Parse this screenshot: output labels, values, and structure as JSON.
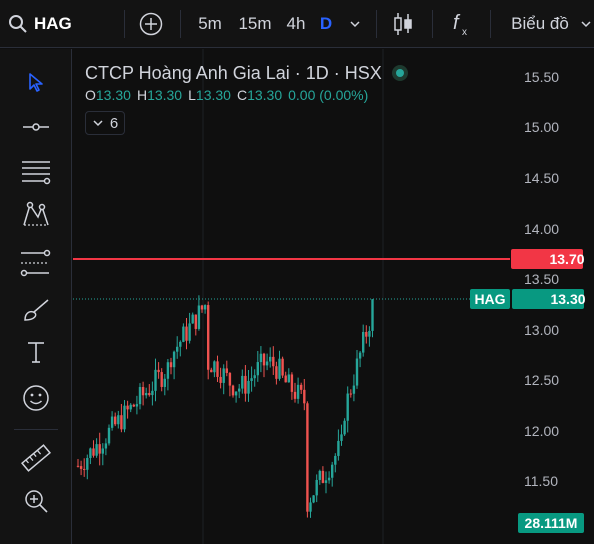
{
  "toolbar": {
    "symbol": "HAG",
    "intervals": [
      "5m",
      "15m",
      "4h",
      "D"
    ],
    "active_interval": "D",
    "chart_type_label": "Biểu đồ"
  },
  "legend": {
    "title": "CTCP Hoàng Anh Gia Lai · 1D · HSX",
    "ohlc": {
      "o_key": "O",
      "o": "13.30",
      "h_key": "H",
      "h": "13.30",
      "l_key": "L",
      "l": "13.30",
      "c_key": "C",
      "c": "13.30",
      "change": "0.00 (0.00%)"
    },
    "indicator_count": "6"
  },
  "price_scale": {
    "ticks": [
      "15.50",
      "15.00",
      "14.50",
      "14.00",
      "13.50",
      "13.00",
      "12.50",
      "12.00",
      "11.50"
    ],
    "alert_line": "13.70",
    "last_price_symbol": "HAG",
    "last_price": "13.30",
    "volume_label": "28.111M"
  },
  "colors": {
    "up": "#26a69a",
    "down": "#ef5350",
    "alert": "#f23645",
    "accent": "#2962ff"
  },
  "left_tools": [
    "cursor-icon",
    "trend-line-icon",
    "fib-icon",
    "pattern-icon",
    "projection-icon",
    "brush-icon",
    "text-icon",
    "emoji-icon",
    "ruler-icon",
    "zoom-in-icon"
  ]
}
